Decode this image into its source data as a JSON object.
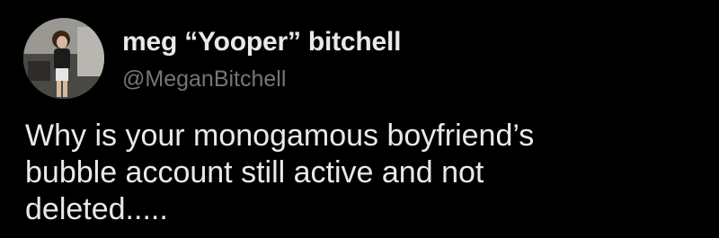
{
  "user": {
    "display_name": "meg “Yooper” bitchell",
    "handle": "@MeganBitchell",
    "avatar_icon": "profile-photo"
  },
  "tweet": {
    "lines": [
      "Why is your monogamous boyfriend’s",
      "bubble account still active and not",
      "deleted....."
    ]
  },
  "colors": {
    "background": "#000000",
    "primary_text": "#e7e9ea",
    "secondary_text": "#71767b"
  }
}
